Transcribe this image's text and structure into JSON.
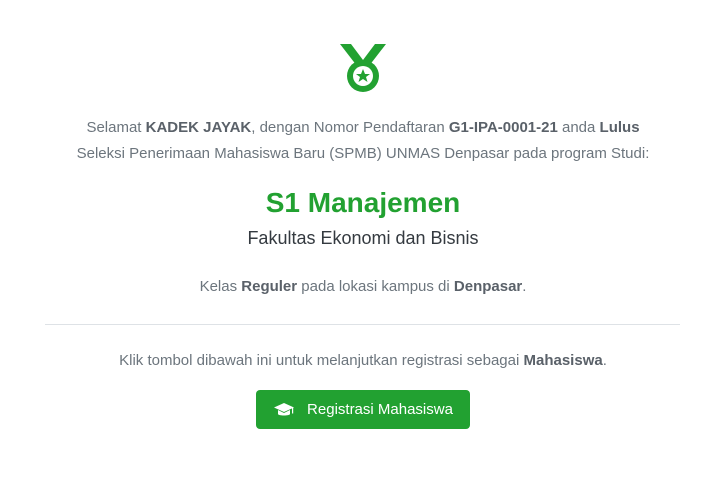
{
  "icons": {
    "medal": "medal-icon",
    "button": "graduation-cap-icon"
  },
  "colors": {
    "accent": "#22a131",
    "text": "#6c757d"
  },
  "message": {
    "greeting": "Selamat",
    "name": "KADEK JAYAK",
    "reg_prefix": ", dengan Nomor Pendaftaran",
    "reg_number": "G1-IPA-0001-21",
    "and": "anda",
    "status": "Lulus",
    "line2": "Seleksi Penerimaan Mahasiswa Baru (SPMB) UNMAS Denpasar pada program Studi:"
  },
  "program": "S1 Manajemen",
  "faculty": "Fakultas Ekonomi dan Bisnis",
  "kelas": {
    "prefix": "Kelas",
    "type": "Reguler",
    "middle": "pada lokasi kampus di",
    "campus": "Denpasar",
    "suffix": "."
  },
  "instruction": {
    "text": "Klik tombol dibawah ini untuk melanjutkan registrasi sebagai",
    "role": "Mahasiswa",
    "suffix": "."
  },
  "button": {
    "label": "Registrasi Mahasiswa"
  }
}
